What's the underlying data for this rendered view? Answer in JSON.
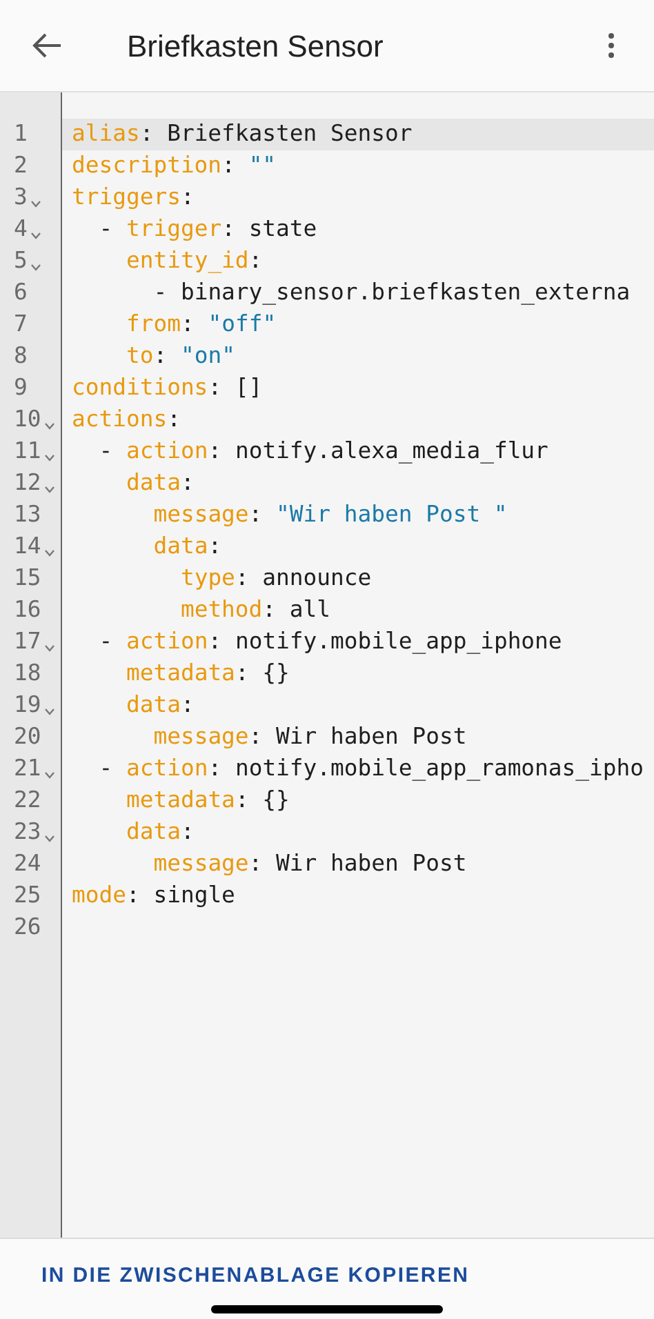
{
  "header": {
    "title": "Briefkasten Sensor"
  },
  "editor": {
    "lines": [
      {
        "number": "1",
        "foldable": false,
        "selected": true,
        "segments": [
          {
            "kind": "key",
            "text": "alias"
          },
          {
            "kind": "plain",
            "text": ": Briefkasten Sensor"
          }
        ]
      },
      {
        "number": "2",
        "foldable": false,
        "selected": false,
        "segments": [
          {
            "kind": "key",
            "text": "description"
          },
          {
            "kind": "plain",
            "text": ": "
          },
          {
            "kind": "string",
            "text": "\"\""
          }
        ]
      },
      {
        "number": "3",
        "foldable": true,
        "selected": false,
        "segments": [
          {
            "kind": "key",
            "text": "triggers"
          },
          {
            "kind": "plain",
            "text": ":"
          }
        ]
      },
      {
        "number": "4",
        "foldable": true,
        "selected": false,
        "segments": [
          {
            "kind": "plain",
            "text": "  - "
          },
          {
            "kind": "key",
            "text": "trigger"
          },
          {
            "kind": "plain",
            "text": ": state"
          }
        ]
      },
      {
        "number": "5",
        "foldable": true,
        "selected": false,
        "segments": [
          {
            "kind": "key",
            "text": "    entity_id"
          },
          {
            "kind": "plain",
            "text": ":"
          }
        ]
      },
      {
        "number": "6",
        "foldable": false,
        "selected": false,
        "segments": [
          {
            "kind": "plain",
            "text": "      - binary_sensor.briefkasten_externa"
          }
        ]
      },
      {
        "number": "7",
        "foldable": false,
        "selected": false,
        "segments": [
          {
            "kind": "key",
            "text": "    from"
          },
          {
            "kind": "plain",
            "text": ": "
          },
          {
            "kind": "string",
            "text": "\"off\""
          }
        ]
      },
      {
        "number": "8",
        "foldable": false,
        "selected": false,
        "segments": [
          {
            "kind": "key",
            "text": "    to"
          },
          {
            "kind": "plain",
            "text": ": "
          },
          {
            "kind": "string",
            "text": "\"on\""
          }
        ]
      },
      {
        "number": "9",
        "foldable": false,
        "selected": false,
        "segments": [
          {
            "kind": "key",
            "text": "conditions"
          },
          {
            "kind": "plain",
            "text": ": []"
          }
        ]
      },
      {
        "number": "10",
        "foldable": true,
        "selected": false,
        "segments": [
          {
            "kind": "key",
            "text": "actions"
          },
          {
            "kind": "plain",
            "text": ":"
          }
        ]
      },
      {
        "number": "11",
        "foldable": true,
        "selected": false,
        "segments": [
          {
            "kind": "plain",
            "text": "  - "
          },
          {
            "kind": "key",
            "text": "action"
          },
          {
            "kind": "plain",
            "text": ": notify.alexa_media_flur"
          }
        ]
      },
      {
        "number": "12",
        "foldable": true,
        "selected": false,
        "segments": [
          {
            "kind": "key",
            "text": "    data"
          },
          {
            "kind": "plain",
            "text": ":"
          }
        ]
      },
      {
        "number": "13",
        "foldable": false,
        "selected": false,
        "segments": [
          {
            "kind": "key",
            "text": "      message"
          },
          {
            "kind": "plain",
            "text": ": "
          },
          {
            "kind": "string",
            "text": "\"Wir haben Post \""
          }
        ]
      },
      {
        "number": "14",
        "foldable": true,
        "selected": false,
        "segments": [
          {
            "kind": "key",
            "text": "      data"
          },
          {
            "kind": "plain",
            "text": ":"
          }
        ]
      },
      {
        "number": "15",
        "foldable": false,
        "selected": false,
        "segments": [
          {
            "kind": "key",
            "text": "        type"
          },
          {
            "kind": "plain",
            "text": ": announce"
          }
        ]
      },
      {
        "number": "16",
        "foldable": false,
        "selected": false,
        "segments": [
          {
            "kind": "key",
            "text": "        method"
          },
          {
            "kind": "plain",
            "text": ": all"
          }
        ]
      },
      {
        "number": "17",
        "foldable": true,
        "selected": false,
        "segments": [
          {
            "kind": "plain",
            "text": "  - "
          },
          {
            "kind": "key",
            "text": "action"
          },
          {
            "kind": "plain",
            "text": ": notify.mobile_app_iphone"
          }
        ]
      },
      {
        "number": "18",
        "foldable": false,
        "selected": false,
        "segments": [
          {
            "kind": "key",
            "text": "    metadata"
          },
          {
            "kind": "plain",
            "text": ": {}"
          }
        ]
      },
      {
        "number": "19",
        "foldable": true,
        "selected": false,
        "segments": [
          {
            "kind": "key",
            "text": "    data"
          },
          {
            "kind": "plain",
            "text": ":"
          }
        ]
      },
      {
        "number": "20",
        "foldable": false,
        "selected": false,
        "segments": [
          {
            "kind": "key",
            "text": "      message"
          },
          {
            "kind": "plain",
            "text": ": Wir haben Post"
          }
        ]
      },
      {
        "number": "21",
        "foldable": true,
        "selected": false,
        "segments": [
          {
            "kind": "plain",
            "text": "  - "
          },
          {
            "kind": "key",
            "text": "action"
          },
          {
            "kind": "plain",
            "text": ": notify.mobile_app_ramonas_ipho"
          }
        ]
      },
      {
        "number": "22",
        "foldable": false,
        "selected": false,
        "segments": [
          {
            "kind": "key",
            "text": "    metadata"
          },
          {
            "kind": "plain",
            "text": ": {}"
          }
        ]
      },
      {
        "number": "23",
        "foldable": true,
        "selected": false,
        "segments": [
          {
            "kind": "key",
            "text": "    data"
          },
          {
            "kind": "plain",
            "text": ":"
          }
        ]
      },
      {
        "number": "24",
        "foldable": false,
        "selected": false,
        "segments": [
          {
            "kind": "key",
            "text": "      message"
          },
          {
            "kind": "plain",
            "text": ": Wir haben Post"
          }
        ]
      },
      {
        "number": "25",
        "foldable": false,
        "selected": false,
        "segments": [
          {
            "kind": "key",
            "text": "mode"
          },
          {
            "kind": "plain",
            "text": ": single"
          }
        ]
      },
      {
        "number": "26",
        "foldable": false,
        "selected": false
      }
    ]
  },
  "footer": {
    "button": "IN DIE ZWISCHENABLAGE KOPIEREN"
  }
}
